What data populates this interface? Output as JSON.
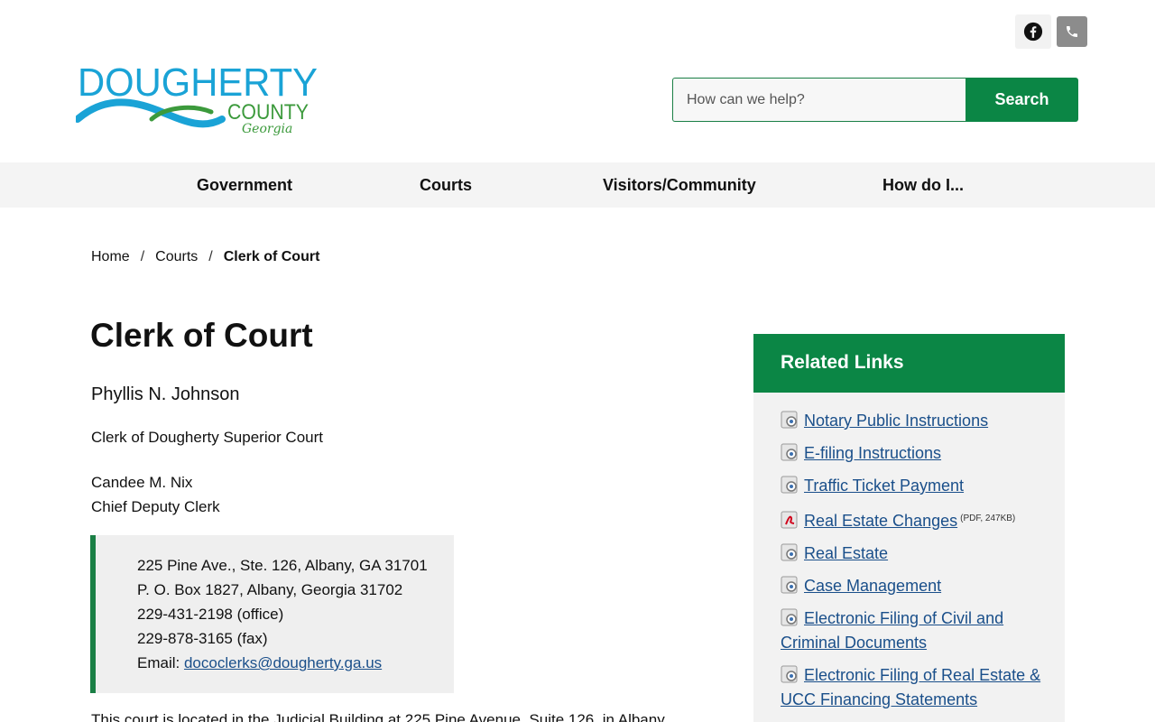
{
  "header": {
    "logo": {
      "word1": "DOUGHERTY",
      "word2": "COUNTY",
      "word3": "Georgia"
    },
    "social": [
      "facebook-icon",
      "phone-icon"
    ],
    "search": {
      "placeholder": "How can we help?",
      "button_label": "Search"
    }
  },
  "nav": {
    "items": [
      {
        "label": "Government"
      },
      {
        "label": "Courts"
      },
      {
        "label": "Visitors/Community"
      },
      {
        "label": "How do I..."
      }
    ]
  },
  "breadcrumb": {
    "home": "Home",
    "section": "Courts",
    "current": "Clerk of Court",
    "separator": "/"
  },
  "main": {
    "title": "Clerk of Court",
    "clerk_name": "Phyllis N. Johnson",
    "clerk_title": "Clerk of Dougherty Superior Court",
    "deputy_name": "Candee M. Nix",
    "deputy_title": "Chief Deputy Clerk",
    "address": {
      "line1": "225 Pine Ave., Ste. 126, Albany, GA 31701",
      "line2": "P. O. Box 1827, Albany, Georgia 31702",
      "line3": "229-431-2198 (office)",
      "line4": "229-878-3165 (fax)",
      "email_label": "Email:",
      "email": "dococlerks@dougherty.ga.us"
    },
    "paragraph_start": "This court is located in the Judicial Building at 225 Pine Avenue, Suite 126, in Albany"
  },
  "sidebar": {
    "title": "Related Links",
    "links": [
      {
        "label": "Notary Public Instructions",
        "icon": "web-link-icon"
      },
      {
        "label": "E-filing Instructions",
        "icon": "web-link-icon"
      },
      {
        "label": "Traffic Ticket Payment",
        "icon": "web-link-icon"
      },
      {
        "label": "Real Estate Changes",
        "icon": "pdf-icon",
        "meta": "(PDF, 247KB)"
      },
      {
        "label": "Real Estate",
        "icon": "web-link-icon"
      },
      {
        "label": "Case Management",
        "icon": "web-link-icon"
      },
      {
        "label": "Electronic Filing of Civil and Criminal Documents",
        "icon": "web-link-icon"
      },
      {
        "label": "Electronic Filing of Real Estate & UCC Financing Statements",
        "icon": "web-link-icon"
      }
    ]
  },
  "colors": {
    "brand_green": "#0b8645",
    "link_blue": "#1a4f8a",
    "logo_blue": "#1aa3d6",
    "logo_green": "#3c9a3c"
  }
}
